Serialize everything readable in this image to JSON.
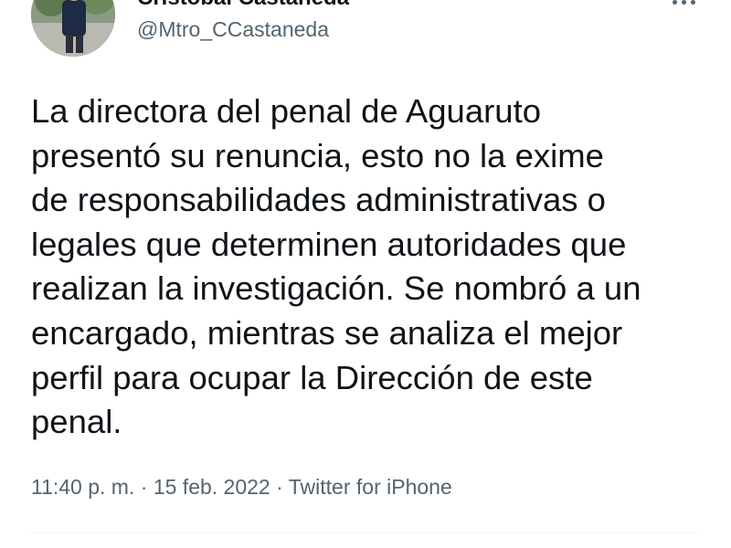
{
  "author": {
    "display_name": "Cristobal Castaneda",
    "handle": "@Mtro_CCastaneda"
  },
  "tweet": {
    "text": "La directora del penal de Aguaruto\npresentó su renuncia, esto no la exime\nde responsabilidades administrativas o\nlegales que determinen autoridades que\nrealizan la investigación. Se nombró a un\nencargado, mientras se analiza el mejor\nperfil para ocupar la Dirección de este\npenal.",
    "time": "11:40 p. m.",
    "separator": " · ",
    "date": "15 feb. 2022",
    "source": "Twitter for iPhone"
  },
  "icons": {
    "more": "more-horizontal-icon"
  },
  "colors": {
    "text": "#0f1419",
    "secondary": "#536471",
    "divider": "#eff3f4"
  }
}
